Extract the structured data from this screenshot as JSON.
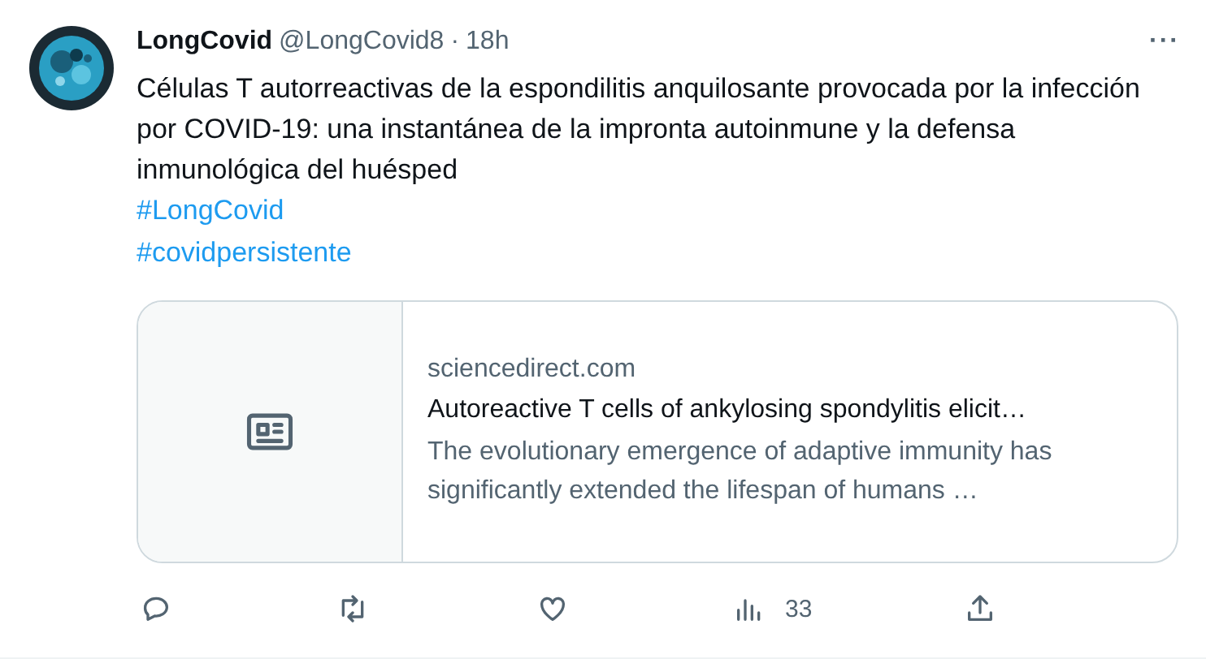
{
  "tweet": {
    "display_name": "LongCovid",
    "handle": "@LongCovid8",
    "separator": "·",
    "time": "18h",
    "more": "···",
    "text": "Células T autorreactivas de la espondilitis anquilosante provocada por la infección por COVID-19: una instantánea de la impronta autoinmune y la defensa inmunológica del huésped",
    "hashtags": [
      "#LongCovid",
      "#covidpersistente"
    ],
    "card": {
      "domain": "sciencedirect.com",
      "title": "Autoreactive T cells of ankylosing spondylitis elicit…",
      "description": "The evolutionary emergence of adaptive immunity has significantly extended the lifespan of humans …"
    },
    "actions": [
      {
        "kind": "reply"
      },
      {
        "kind": "retweet"
      },
      {
        "kind": "like"
      },
      {
        "kind": "views",
        "count": "33"
      },
      {
        "kind": "share"
      }
    ]
  }
}
